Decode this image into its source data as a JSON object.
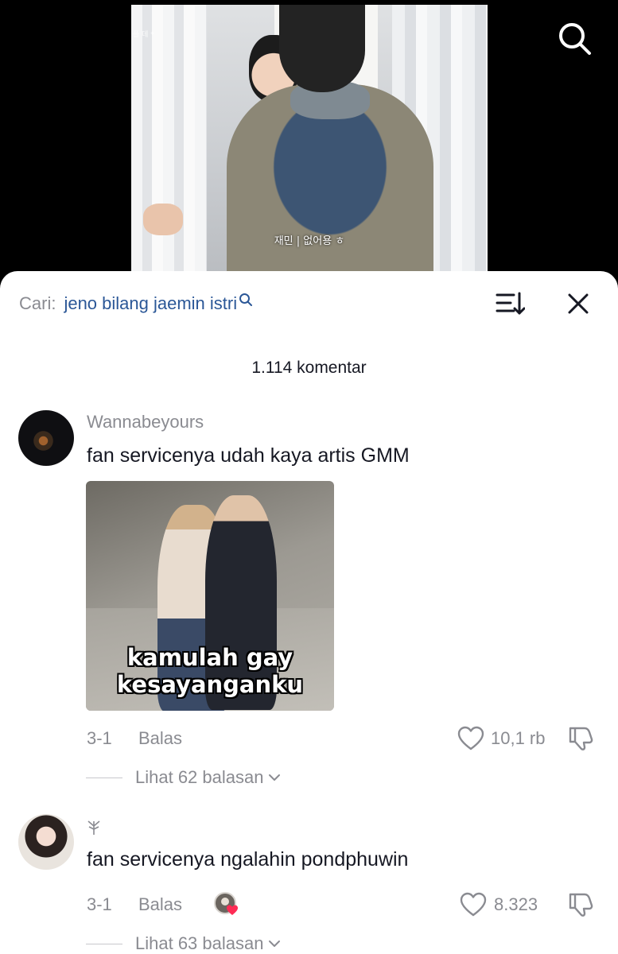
{
  "video": {
    "subtitle": "재민 | 없어용 ㅎ",
    "watermark": "플 데 *"
  },
  "search": {
    "prefix": "Cari:",
    "query": "jeno bilang jaemin istri"
  },
  "comments_count": "1.114 komentar",
  "comments": [
    {
      "username": "Wannabeyours",
      "text": "fan servicenya udah kaya artis GMM",
      "gif_caption_line1": "kamulah gay",
      "gif_caption_line2": "kesayanganku",
      "date": "3-1",
      "reply_label": "Balas",
      "likes": "10,1 rb",
      "view_replies": "Lihat 62 balasan"
    },
    {
      "username": "",
      "text": "fan servicenya ngalahin pondphuwin",
      "date": "3-1",
      "reply_label": "Balas",
      "likes": "8.323",
      "view_replies": "Lihat 63 balasan"
    }
  ],
  "icons": {
    "top_search": "search-icon",
    "search_glass": "search-icon",
    "sort": "sort-icon",
    "close": "close-icon",
    "like": "heart-icon",
    "dislike": "dislike-icon",
    "chevron": "chevron-down-icon",
    "creator_reaction": "heart-badge-icon",
    "special_name": "tree-icon"
  },
  "colors": {
    "query": "#2b5797",
    "muted": "#8a8b91",
    "text": "#161823",
    "heart_badge": "#fe2c55"
  }
}
